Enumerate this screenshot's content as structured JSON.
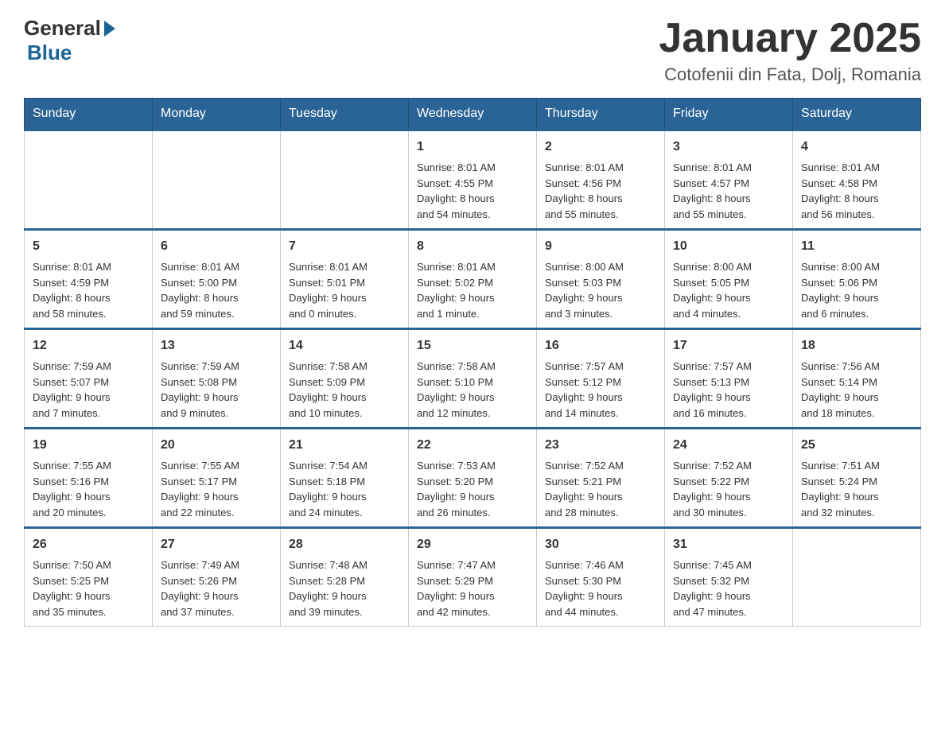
{
  "header": {
    "logo_general": "General",
    "logo_blue": "Blue",
    "month_title": "January 2025",
    "location": "Cotofenii din Fata, Dolj, Romania"
  },
  "days_of_week": [
    "Sunday",
    "Monday",
    "Tuesday",
    "Wednesday",
    "Thursday",
    "Friday",
    "Saturday"
  ],
  "weeks": [
    [
      {
        "day": "",
        "info": ""
      },
      {
        "day": "",
        "info": ""
      },
      {
        "day": "",
        "info": ""
      },
      {
        "day": "1",
        "info": "Sunrise: 8:01 AM\nSunset: 4:55 PM\nDaylight: 8 hours\nand 54 minutes."
      },
      {
        "day": "2",
        "info": "Sunrise: 8:01 AM\nSunset: 4:56 PM\nDaylight: 8 hours\nand 55 minutes."
      },
      {
        "day": "3",
        "info": "Sunrise: 8:01 AM\nSunset: 4:57 PM\nDaylight: 8 hours\nand 55 minutes."
      },
      {
        "day": "4",
        "info": "Sunrise: 8:01 AM\nSunset: 4:58 PM\nDaylight: 8 hours\nand 56 minutes."
      }
    ],
    [
      {
        "day": "5",
        "info": "Sunrise: 8:01 AM\nSunset: 4:59 PM\nDaylight: 8 hours\nand 58 minutes."
      },
      {
        "day": "6",
        "info": "Sunrise: 8:01 AM\nSunset: 5:00 PM\nDaylight: 8 hours\nand 59 minutes."
      },
      {
        "day": "7",
        "info": "Sunrise: 8:01 AM\nSunset: 5:01 PM\nDaylight: 9 hours\nand 0 minutes."
      },
      {
        "day": "8",
        "info": "Sunrise: 8:01 AM\nSunset: 5:02 PM\nDaylight: 9 hours\nand 1 minute."
      },
      {
        "day": "9",
        "info": "Sunrise: 8:00 AM\nSunset: 5:03 PM\nDaylight: 9 hours\nand 3 minutes."
      },
      {
        "day": "10",
        "info": "Sunrise: 8:00 AM\nSunset: 5:05 PM\nDaylight: 9 hours\nand 4 minutes."
      },
      {
        "day": "11",
        "info": "Sunrise: 8:00 AM\nSunset: 5:06 PM\nDaylight: 9 hours\nand 6 minutes."
      }
    ],
    [
      {
        "day": "12",
        "info": "Sunrise: 7:59 AM\nSunset: 5:07 PM\nDaylight: 9 hours\nand 7 minutes."
      },
      {
        "day": "13",
        "info": "Sunrise: 7:59 AM\nSunset: 5:08 PM\nDaylight: 9 hours\nand 9 minutes."
      },
      {
        "day": "14",
        "info": "Sunrise: 7:58 AM\nSunset: 5:09 PM\nDaylight: 9 hours\nand 10 minutes."
      },
      {
        "day": "15",
        "info": "Sunrise: 7:58 AM\nSunset: 5:10 PM\nDaylight: 9 hours\nand 12 minutes."
      },
      {
        "day": "16",
        "info": "Sunrise: 7:57 AM\nSunset: 5:12 PM\nDaylight: 9 hours\nand 14 minutes."
      },
      {
        "day": "17",
        "info": "Sunrise: 7:57 AM\nSunset: 5:13 PM\nDaylight: 9 hours\nand 16 minutes."
      },
      {
        "day": "18",
        "info": "Sunrise: 7:56 AM\nSunset: 5:14 PM\nDaylight: 9 hours\nand 18 minutes."
      }
    ],
    [
      {
        "day": "19",
        "info": "Sunrise: 7:55 AM\nSunset: 5:16 PM\nDaylight: 9 hours\nand 20 minutes."
      },
      {
        "day": "20",
        "info": "Sunrise: 7:55 AM\nSunset: 5:17 PM\nDaylight: 9 hours\nand 22 minutes."
      },
      {
        "day": "21",
        "info": "Sunrise: 7:54 AM\nSunset: 5:18 PM\nDaylight: 9 hours\nand 24 minutes."
      },
      {
        "day": "22",
        "info": "Sunrise: 7:53 AM\nSunset: 5:20 PM\nDaylight: 9 hours\nand 26 minutes."
      },
      {
        "day": "23",
        "info": "Sunrise: 7:52 AM\nSunset: 5:21 PM\nDaylight: 9 hours\nand 28 minutes."
      },
      {
        "day": "24",
        "info": "Sunrise: 7:52 AM\nSunset: 5:22 PM\nDaylight: 9 hours\nand 30 minutes."
      },
      {
        "day": "25",
        "info": "Sunrise: 7:51 AM\nSunset: 5:24 PM\nDaylight: 9 hours\nand 32 minutes."
      }
    ],
    [
      {
        "day": "26",
        "info": "Sunrise: 7:50 AM\nSunset: 5:25 PM\nDaylight: 9 hours\nand 35 minutes."
      },
      {
        "day": "27",
        "info": "Sunrise: 7:49 AM\nSunset: 5:26 PM\nDaylight: 9 hours\nand 37 minutes."
      },
      {
        "day": "28",
        "info": "Sunrise: 7:48 AM\nSunset: 5:28 PM\nDaylight: 9 hours\nand 39 minutes."
      },
      {
        "day": "29",
        "info": "Sunrise: 7:47 AM\nSunset: 5:29 PM\nDaylight: 9 hours\nand 42 minutes."
      },
      {
        "day": "30",
        "info": "Sunrise: 7:46 AM\nSunset: 5:30 PM\nDaylight: 9 hours\nand 44 minutes."
      },
      {
        "day": "31",
        "info": "Sunrise: 7:45 AM\nSunset: 5:32 PM\nDaylight: 9 hours\nand 47 minutes."
      },
      {
        "day": "",
        "info": ""
      }
    ]
  ]
}
